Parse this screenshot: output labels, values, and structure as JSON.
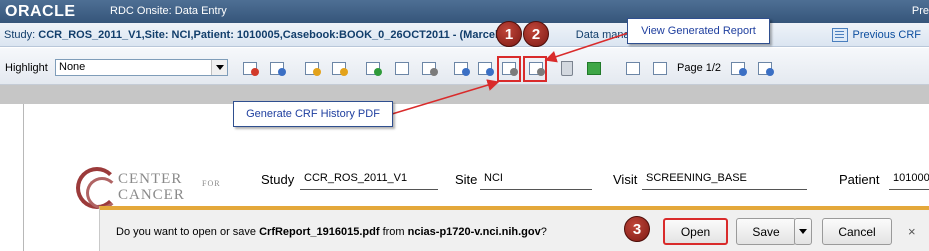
{
  "titlebar": {
    "brand": "ORACLE",
    "title": "RDC Onsite: Data Entry",
    "right_text": "Pre"
  },
  "studybar": {
    "prefix": "Study:",
    "context": "CCR_ROS_2011_V1,Site: NCI,Patient: 1010005,Casebook:BOOK_0_26OCT2011 - (Marcelo",
    "suffix": "Data manageme",
    "previous_crf": "Previous CRF"
  },
  "toolbar": {
    "highlight_label": "Highlight",
    "highlight_value": "None",
    "page_label": "Page 1/2"
  },
  "icons": [
    "add-red-icon",
    "add-blue-icon",
    "edit-icon",
    "verify-icon",
    "approve-icon",
    "discrepancy-icon",
    "history-icon",
    "audit-icon",
    "crf-history-pdf-icon",
    "view-generated-report-icon",
    "trash-icon",
    "save-icon",
    "first-page-icon",
    "prev-page-icon",
    "next-page-icon",
    "last-page-icon"
  ],
  "form": {
    "logo_line1": "CENTER",
    "logo_for": "FOR",
    "logo_line2": "CANCER",
    "study_label": "Study",
    "study_value": "CCR_ROS_2011_V1",
    "site_label": "Site",
    "site_value": "NCI",
    "visit_label": "Visit",
    "visit_value": "SCREENING_BASE",
    "patient_label": "Patient",
    "patient_value": "101000"
  },
  "download": {
    "prompt": "Do you want to open or save ",
    "filename": "CrfReport_1916015.pdf",
    "from": " from ",
    "host": "ncias-p1720-v.nci.nih.gov",
    "question": "?",
    "open": "Open",
    "save": "Save",
    "cancel": "Cancel",
    "close": "×"
  },
  "annotations": {
    "callout_report": "View Generated Report",
    "callout_pdf": "Generate CRF History PDF",
    "badge1": "1",
    "badge2": "2",
    "badge3": "3",
    "color": "#d92b2b"
  }
}
